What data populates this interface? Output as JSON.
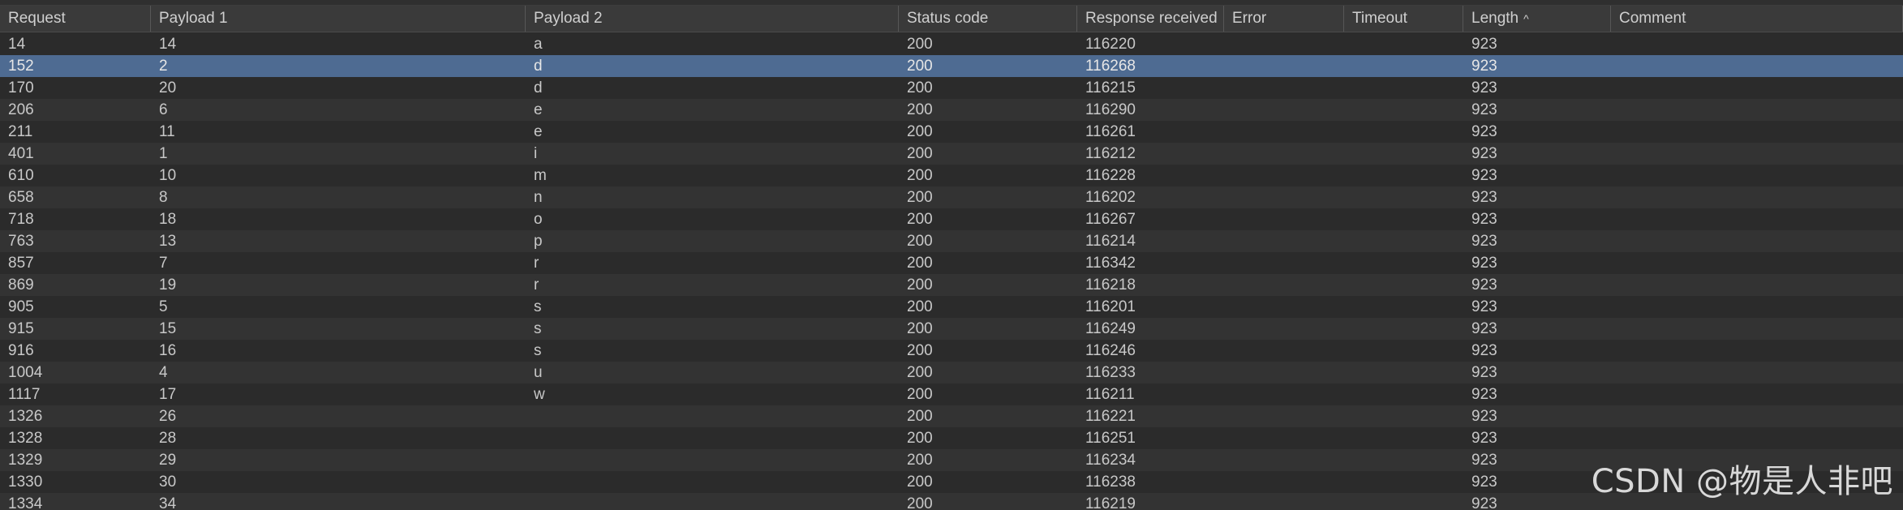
{
  "table": {
    "columns": [
      "Request",
      "Payload 1",
      "Payload 2",
      "Status code",
      "Response received",
      "Error",
      "Timeout",
      "Length",
      "Comment"
    ],
    "sort_column": "Length",
    "sort_indicator": "^",
    "selected_row": 1,
    "rows": [
      [
        "14",
        "14",
        "a",
        "200",
        "116220",
        "",
        "",
        "923",
        ""
      ],
      [
        "152",
        "2",
        "d",
        "200",
        "116268",
        "",
        "",
        "923",
        ""
      ],
      [
        "170",
        "20",
        "d",
        "200",
        "116215",
        "",
        "",
        "923",
        ""
      ],
      [
        "206",
        "6",
        "e",
        "200",
        "116290",
        "",
        "",
        "923",
        ""
      ],
      [
        "211",
        "11",
        "e",
        "200",
        "116261",
        "",
        "",
        "923",
        ""
      ],
      [
        "401",
        "1",
        "i",
        "200",
        "116212",
        "",
        "",
        "923",
        ""
      ],
      [
        "610",
        "10",
        "m",
        "200",
        "116228",
        "",
        "",
        "923",
        ""
      ],
      [
        "658",
        "8",
        "n",
        "200",
        "116202",
        "",
        "",
        "923",
        ""
      ],
      [
        "718",
        "18",
        "o",
        "200",
        "116267",
        "",
        "",
        "923",
        ""
      ],
      [
        "763",
        "13",
        "p",
        "200",
        "116214",
        "",
        "",
        "923",
        ""
      ],
      [
        "857",
        "7",
        "r",
        "200",
        "116342",
        "",
        "",
        "923",
        ""
      ],
      [
        "869",
        "19",
        "r",
        "200",
        "116218",
        "",
        "",
        "923",
        ""
      ],
      [
        "905",
        "5",
        "s",
        "200",
        "116201",
        "",
        "",
        "923",
        ""
      ],
      [
        "915",
        "15",
        "s",
        "200",
        "116249",
        "",
        "",
        "923",
        ""
      ],
      [
        "916",
        "16",
        "s",
        "200",
        "116246",
        "",
        "",
        "923",
        ""
      ],
      [
        "1004",
        "4",
        "u",
        "200",
        "116233",
        "",
        "",
        "923",
        ""
      ],
      [
        "1117",
        "17",
        "w",
        "200",
        "116211",
        "",
        "",
        "923",
        ""
      ],
      [
        "1326",
        "26",
        "",
        "200",
        "116221",
        "",
        "",
        "923",
        ""
      ],
      [
        "1328",
        "28",
        "",
        "200",
        "116251",
        "",
        "",
        "923",
        ""
      ],
      [
        "1329",
        "29",
        "",
        "200",
        "116234",
        "",
        "",
        "923",
        ""
      ],
      [
        "1330",
        "30",
        "",
        "200",
        "116238",
        "",
        "",
        "923",
        ""
      ],
      [
        "1334",
        "34",
        "",
        "200",
        "116219",
        "",
        "",
        "923",
        ""
      ]
    ]
  },
  "watermark": "CSDN @物是人非吧",
  "colors": {
    "background": "#2b2b2b",
    "row_alt": "#333333",
    "selected": "#4e6b92",
    "header": "#3a3a3a"
  },
  "icons": {
    "sort": "sort-ascending-icon"
  }
}
